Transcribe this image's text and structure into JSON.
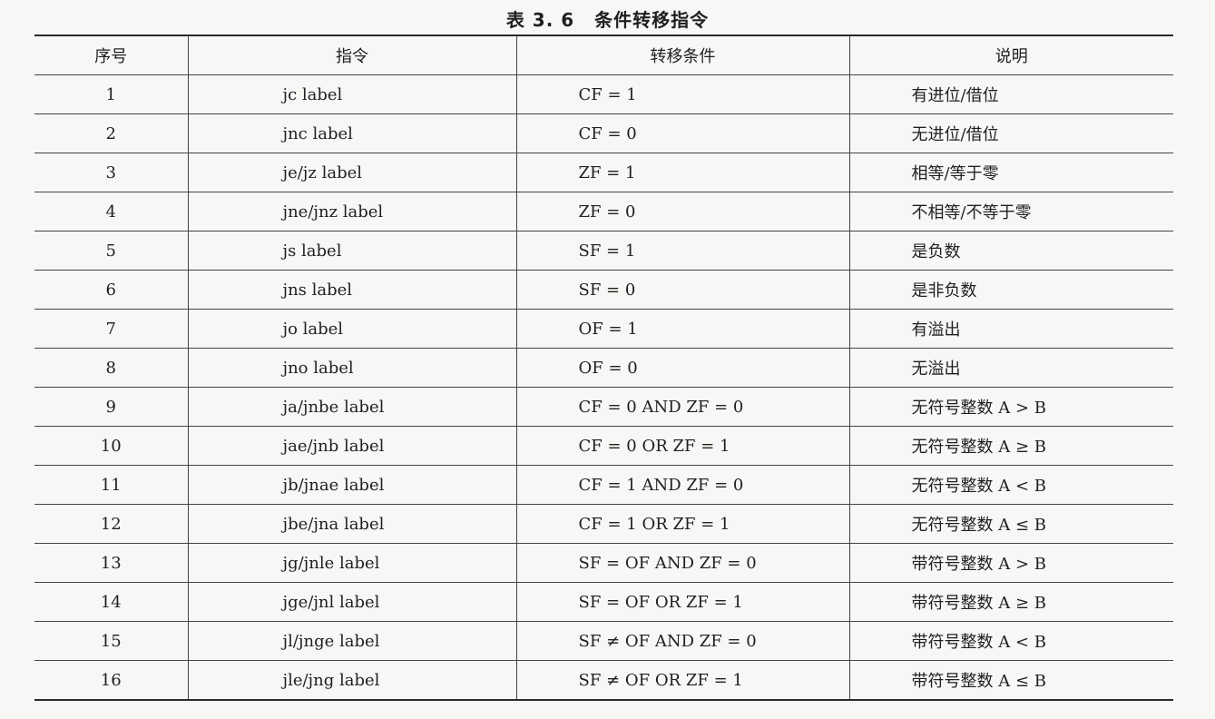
{
  "caption": {
    "number": "表 3. 6",
    "title": "条件转移指令"
  },
  "table": {
    "headers": [
      "序号",
      "指令",
      "转移条件",
      "说明"
    ],
    "rows": [
      [
        "1",
        "jc label",
        "CF = 1",
        "有进位/借位"
      ],
      [
        "2",
        "jnc label",
        "CF = 0",
        "无进位/借位"
      ],
      [
        "3",
        "je/jz label",
        "ZF = 1",
        "相等/等于零"
      ],
      [
        "4",
        "jne/jnz label",
        "ZF = 0",
        "不相等/不等于零"
      ],
      [
        "5",
        "js label",
        "SF = 1",
        "是负数"
      ],
      [
        "6",
        "jns label",
        "SF = 0",
        "是非负数"
      ],
      [
        "7",
        "jo label",
        "OF = 1",
        "有溢出"
      ],
      [
        "8",
        "jno label",
        "OF = 0",
        "无溢出"
      ],
      [
        "9",
        "ja/jnbe label",
        "CF = 0  AND  ZF = 0",
        "无符号整数 A > B"
      ],
      [
        "10",
        "jae/jnb label",
        "CF = 0  OR  ZF = 1",
        "无符号整数 A ≥ B"
      ],
      [
        "11",
        "jb/jnae label",
        "CF = 1  AND  ZF = 0",
        "无符号整数 A < B"
      ],
      [
        "12",
        "jbe/jna label",
        "CF = 1  OR  ZF = 1",
        "无符号整数 A ≤ B"
      ],
      [
        "13",
        "jg/jnle label",
        "SF = OF  AND  ZF = 0",
        "带符号整数 A > B"
      ],
      [
        "14",
        "jge/jnl label",
        "SF = OF  OR  ZF = 1",
        "带符号整数 A ≥ B"
      ],
      [
        "15",
        "jl/jnge label",
        "SF ≠ OF  AND  ZF = 0",
        "带符号整数 A < B"
      ],
      [
        "16",
        "jle/jng label",
        "SF ≠ OF  OR  ZF = 1",
        "带符号整数 A ≤ B"
      ]
    ]
  }
}
